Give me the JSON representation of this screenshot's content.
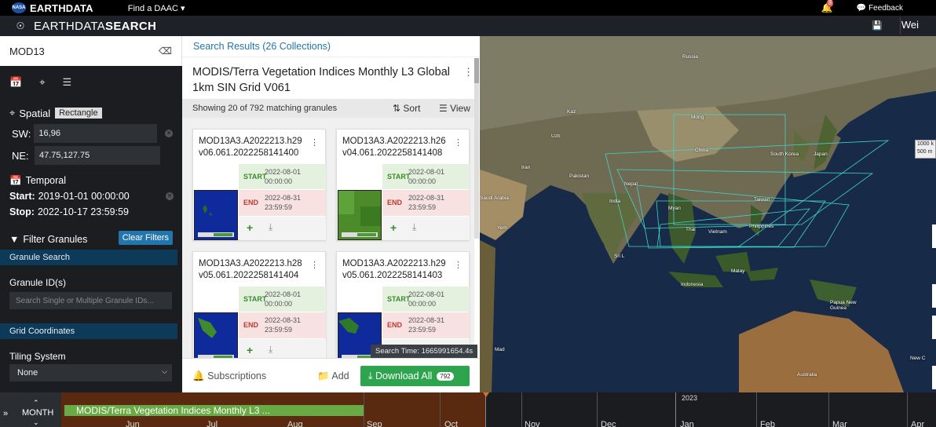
{
  "topbar": {
    "logo_text": "NASA",
    "brand": "EARTHDATA",
    "find_daac": "Find a DAAC ▾",
    "notification_count": "8",
    "feedback": "Feedback"
  },
  "header": {
    "title_light": "EARTHDATA",
    "title_bold": "SEARCH",
    "user": "Wei"
  },
  "sidebar": {
    "search_value": "MOD13",
    "spatial_label": "Spatial",
    "spatial_type": "Rectangle",
    "sw_label": "SW:",
    "sw_value": "16,96",
    "ne_label": "NE:",
    "ne_value": "47.75,127.75",
    "temporal_label": "Temporal",
    "start_label": "Start:",
    "start_value": "2019-01-01 00:00:00",
    "stop_label": "Stop:",
    "stop_value": "2022-10-17 23:59:59",
    "filter_label": "Filter Granules",
    "clear_filters": "Clear Filters",
    "granule_search": "Granule Search",
    "granule_ids_label": "Granule ID(s)",
    "granule_ids_placeholder": "Search Single or Multiple Granule IDs...",
    "grid_coordinates": "Grid Coordinates",
    "tiling_label": "Tiling System",
    "tiling_value": "None"
  },
  "results": {
    "heading": "Search Results (26 Collections)",
    "collection_title": "MODIS/Terra Vegetation Indices Monthly L3 Global 1km SIN Grid V061",
    "showing": "Showing 20 of 792 matching granules",
    "sort": "Sort",
    "view": "View",
    "search_time": "Search Time: 1665991654.4s",
    "subscriptions": "Subscriptions",
    "add": "Add",
    "download_all": "Download All",
    "download_count": "792",
    "granules": [
      {
        "id_line1": "MOD13A3.A2022213.h29",
        "id_line2": "v06.061.2022258141400",
        "start_label": "START",
        "start_date": "2022-08-01",
        "start_time": "00:00:00",
        "end_label": "END",
        "end_date": "2022-08-31",
        "end_time": "23:59:59"
      },
      {
        "id_line1": "MOD13A3.A2022213.h26",
        "id_line2": "v04.061.2022258141408",
        "start_label": "START",
        "start_date": "2022-08-01",
        "start_time": "00:00:00",
        "end_label": "END",
        "end_date": "2022-08-31",
        "end_time": "23:59:59"
      },
      {
        "id_line1": "MOD13A3.A2022213.h28",
        "id_line2": "v05.061.2022258141404",
        "start_label": "START",
        "start_date": "2022-08-01",
        "start_time": "00:00:00",
        "end_label": "END",
        "end_date": "2022-08-31",
        "end_time": "23:59:59"
      },
      {
        "id_line1": "MOD13A3.A2022213.h29",
        "id_line2": "v05.061.2022258141403",
        "start_label": "START",
        "start_date": "2022-08-01",
        "start_time": "00:00:00",
        "end_label": "END",
        "end_date": "2022-08-31",
        "end_time": "23:59:59"
      }
    ]
  },
  "map": {
    "labels": [
      "Russia",
      "Mong",
      "China",
      "South Korea",
      "Japan",
      "Iran",
      "Pakistan",
      "India",
      "Nepal",
      "Taiwan",
      "Philippines",
      "Myan",
      "Thai",
      "Vietnam",
      "Malay",
      "Indonesia",
      "Sri L",
      "Papua New Guinea",
      "Australia",
      "Kaz",
      "Uzb",
      "Saudi Arabia",
      "Yem",
      "Mad",
      "New C"
    ],
    "scale_1": "1000 k",
    "scale_2": "500 m"
  },
  "timeline": {
    "zoom_label": "MONTH",
    "bar_label": "MODIS/Terra Vegetation Indices Monthly L3 ...",
    "year": "2023",
    "months": [
      "Jun",
      "Jul",
      "Aug",
      "Sep",
      "Oct",
      "Nov",
      "Dec",
      "Jan",
      "Feb",
      "Mar",
      "Apr"
    ]
  },
  "colors": {
    "accent": "#2276ac",
    "download_green": "#2ea44f",
    "start_green": "#3a8a2a",
    "end_red": "#c0392b",
    "timeline_bar": "#6aaa45",
    "timeline_range": "#5a2a10"
  }
}
